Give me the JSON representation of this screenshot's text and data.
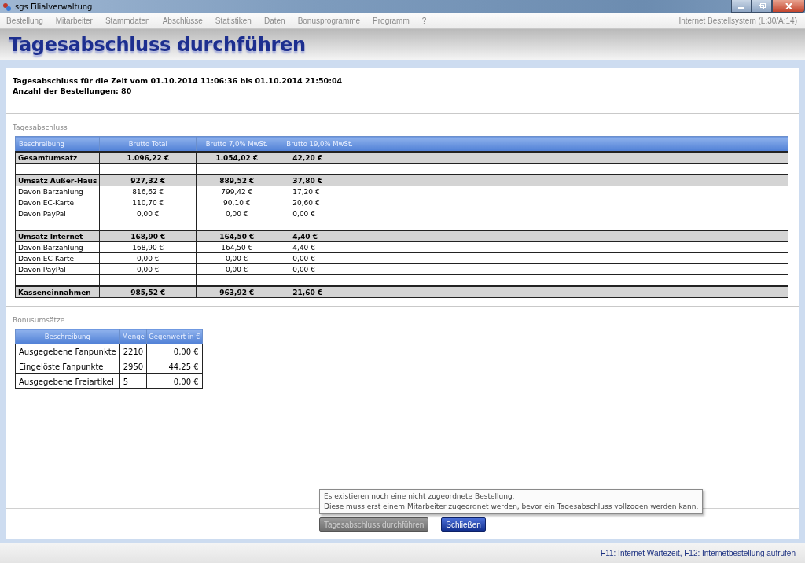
{
  "window": {
    "title": "sgs Filialverwaltung"
  },
  "menu": {
    "items": [
      "Bestellung",
      "Mitarbeiter",
      "Stammdaten",
      "Abschlüsse",
      "Statistiken",
      "Daten",
      "Bonusprogramme",
      "Programm",
      "?"
    ],
    "status": "Internet Bestellsystem (L:30/A:14)"
  },
  "page_title": "Tagesabschluss durchführen",
  "info": [
    "Tagesabschluss für die Zeit vom 01.10.2014 11:06:36 bis 01.10.2014 21:50:04",
    "Anzahl der Bestellungen: 80"
  ],
  "summary": {
    "heading": "Tagesabschluss",
    "columns": [
      "Beschreibung",
      "Brutto Total",
      "Brutto 7,0% MwSt.",
      "Brutto 19,0% MwSt."
    ],
    "rows": [
      {
        "kind": "total",
        "cells": [
          "Gesamtumsatz",
          "1.096,22 €",
          "1.054,02 €",
          "42,20 €"
        ]
      },
      {
        "kind": "spacer"
      },
      {
        "kind": "total",
        "cells": [
          "Umsatz Außer-Haus",
          "927,32 €",
          "889,52 €",
          "37,80 €"
        ]
      },
      {
        "kind": "detail",
        "cells": [
          "Davon Barzahlung",
          "816,62 €",
          "799,42 €",
          "17,20 €"
        ]
      },
      {
        "kind": "detail",
        "cells": [
          "Davon EC-Karte",
          "110,70 €",
          "90,10 €",
          "20,60 €"
        ]
      },
      {
        "kind": "detail",
        "cells": [
          "Davon PayPal",
          "0,00 €",
          "0,00 €",
          "0,00 €"
        ]
      },
      {
        "kind": "spacer"
      },
      {
        "kind": "total",
        "cells": [
          "Umsatz Internet",
          "168,90 €",
          "164,50 €",
          "4,40 €"
        ]
      },
      {
        "kind": "detail",
        "cells": [
          "Davon Barzahlung",
          "168,90 €",
          "164,50 €",
          "4,40 €"
        ]
      },
      {
        "kind": "detail",
        "cells": [
          "Davon EC-Karte",
          "0,00 €",
          "0,00 €",
          "0,00 €"
        ]
      },
      {
        "kind": "detail",
        "cells": [
          "Davon PayPal",
          "0,00 €",
          "0,00 €",
          "0,00 €"
        ]
      },
      {
        "kind": "spacer"
      },
      {
        "kind": "total",
        "cells": [
          "Kasseneinnahmen",
          "985,52 €",
          "963,92 €",
          "21,60 €"
        ]
      }
    ]
  },
  "bonus": {
    "heading": "Bonusumsätze",
    "columns": [
      "Beschreibung",
      "Menge",
      "Gegenwert in €"
    ],
    "rows": [
      [
        "Ausgegebene Fanpunkte",
        "2210",
        "0,00 €"
      ],
      [
        "Eingelöste Fanpunkte",
        "2950",
        "44,25 €"
      ],
      [
        "Ausgegebene Freiartikel",
        "5",
        "0,00 €"
      ]
    ]
  },
  "tooltip": [
    "Es existieren noch eine nicht zugeordnete Bestellung.",
    "Diese muss erst einem Mitarbeiter zugeordnet werden, bevor ein Tagesabschluss vollzogen werden kann."
  ],
  "buttons": [
    {
      "label": "Tagesabschluss durchführen",
      "disabled": true
    },
    {
      "label": "Schließen",
      "disabled": false
    }
  ],
  "status_bar": "F11: Internet Wartezeit, F12: Internetbestellung aufrufen"
}
